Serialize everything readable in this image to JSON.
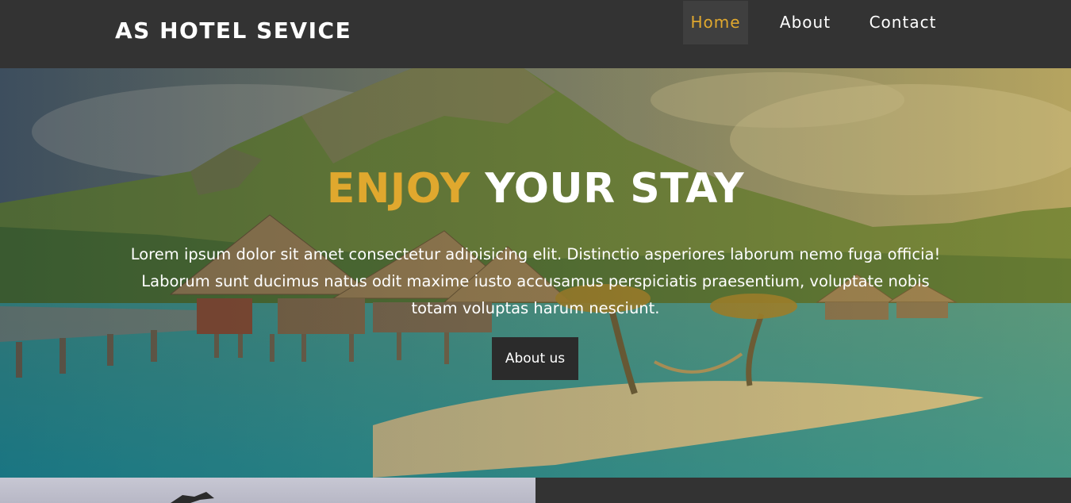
{
  "header": {
    "brand": "AS HOTEL SEVICE",
    "nav": [
      {
        "label": "Home",
        "active": true
      },
      {
        "label": "About",
        "active": false
      },
      {
        "label": "Contact",
        "active": false
      }
    ]
  },
  "hero": {
    "title_accent": "ENJOY",
    "title_rest": "YOUR STAY",
    "text": "Lorem ipsum dolor sit amet consectetur adipisicing elit. Distinctio asperiores laborum nemo fuga officia! Laborum sunt ducimus natus odit maxime iusto accusamus perspiciatis praesentium, voluptate nobis totam voluptas harum nesciunt.",
    "button_label": "About us"
  },
  "colors": {
    "accent": "#e0a82e",
    "nav_background": "#333333",
    "active_nav_background": "#3f3f3f",
    "button_background": "#2b2b2b"
  }
}
